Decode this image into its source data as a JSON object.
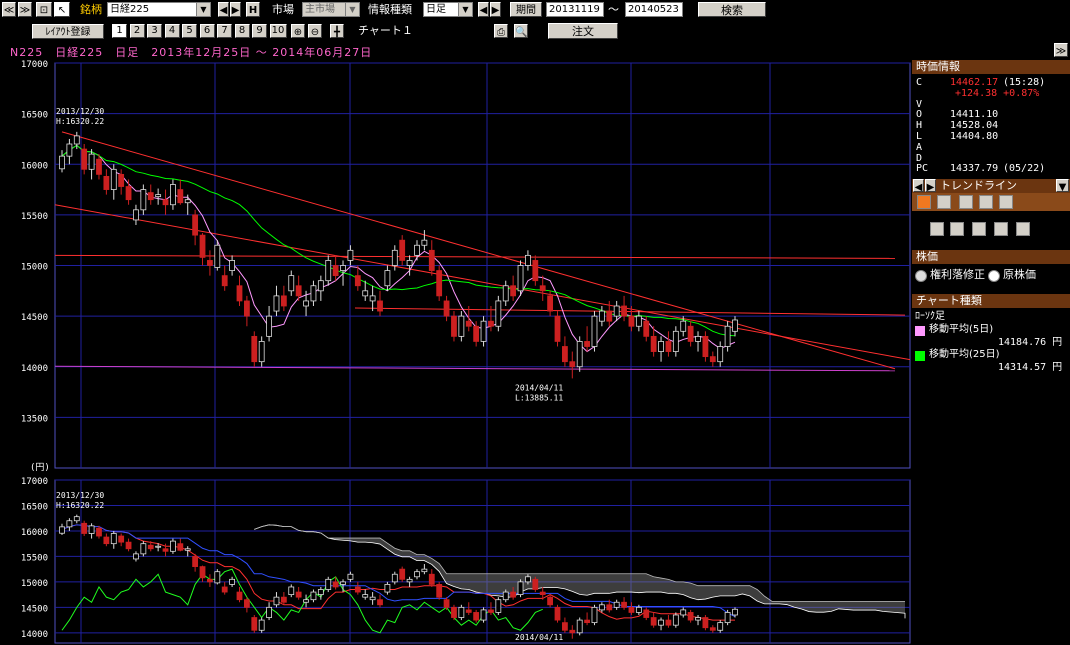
{
  "toolbar": {
    "symbol_label": "銘柄",
    "symbol_value": "日経225",
    "h_button": "H",
    "market_label": "市場",
    "market_value": "主市場",
    "info_label": "情報種類",
    "info_value": "日足",
    "period_label": "期間",
    "period_from": "20131119",
    "tilde": "〜",
    "period_to": "20140523",
    "search_button": "検索",
    "layout_label": "ﾚｲｱｳﾄ登録",
    "layout_numbers": [
      "1",
      "2",
      "3",
      "4",
      "5",
      "6",
      "7",
      "8",
      "9",
      "10"
    ],
    "chart_tab": "チャート１",
    "order_button": "注文"
  },
  "chart_title": "N225　日経225　日足　2013年12月25日 〜 2014年06月27日",
  "chart_data": [
    {
      "type": "candlestick",
      "y_ticks": [
        "17000",
        "16500",
        "16000",
        "15500",
        "15000",
        "14500",
        "14000",
        "13500"
      ],
      "ylim": [
        13000,
        17000
      ],
      "unit_label": "(円)",
      "annotations": [
        {
          "date_text": "2013/12/30",
          "value_text": "H:16320.22"
        },
        {
          "date_text": "2014/04/11",
          "value_text": "L:13885.11"
        }
      ],
      "candles": [
        [
          15955,
          16140,
          15920,
          16080
        ],
        [
          16080,
          16250,
          16000,
          16200
        ],
        [
          16200,
          16320,
          16150,
          16280
        ],
        [
          16150,
          16200,
          15900,
          15950
        ],
        [
          15950,
          16150,
          15850,
          16100
        ],
        [
          16050,
          16100,
          15850,
          15900
        ],
        [
          15880,
          15950,
          15700,
          15750
        ],
        [
          15750,
          16000,
          15650,
          15950
        ],
        [
          15900,
          15950,
          15700,
          15780
        ],
        [
          15780,
          15850,
          15600,
          15650
        ],
        [
          15450,
          15600,
          15400,
          15550
        ],
        [
          15550,
          15800,
          15500,
          15750
        ],
        [
          15720,
          15800,
          15600,
          15650
        ],
        [
          15680,
          15760,
          15600,
          15700
        ],
        [
          15650,
          15750,
          15500,
          15600
        ],
        [
          15600,
          15850,
          15550,
          15800
        ],
        [
          15750,
          15850,
          15600,
          15620
        ],
        [
          15620,
          15700,
          15500,
          15650
        ],
        [
          15500,
          15550,
          15200,
          15300
        ],
        [
          15300,
          15320,
          15000,
          15080
        ],
        [
          15050,
          15150,
          14900,
          15000
        ],
        [
          14980,
          15250,
          14950,
          15200
        ],
        [
          14900,
          15000,
          14750,
          14800
        ],
        [
          14950,
          15100,
          14900,
          15050
        ],
        [
          14800,
          14900,
          14600,
          14650
        ],
        [
          14650,
          14700,
          14400,
          14500
        ],
        [
          14300,
          14350,
          14000,
          14050
        ],
        [
          14050,
          14300,
          14000,
          14250
        ],
        [
          14300,
          14600,
          14250,
          14500
        ],
        [
          14550,
          14800,
          14500,
          14700
        ],
        [
          14700,
          14800,
          14550,
          14600
        ],
        [
          14750,
          14950,
          14700,
          14900
        ],
        [
          14800,
          14900,
          14650,
          14700
        ],
        [
          14600,
          14750,
          14500,
          14650
        ],
        [
          14650,
          14850,
          14600,
          14800
        ],
        [
          14750,
          14900,
          14650,
          14850
        ],
        [
          14850,
          15100,
          14800,
          15050
        ],
        [
          15000,
          15100,
          14850,
          14900
        ],
        [
          14950,
          15050,
          14800,
          15000
        ],
        [
          15050,
          15200,
          15000,
          15150
        ],
        [
          14900,
          15000,
          14750,
          14800
        ],
        [
          14700,
          14850,
          14650,
          14750
        ],
        [
          14650,
          14800,
          14550,
          14700
        ],
        [
          14650,
          14750,
          14500,
          14550
        ],
        [
          14800,
          15000,
          14750,
          14950
        ],
        [
          15000,
          15200,
          14950,
          15150
        ],
        [
          15250,
          15300,
          15000,
          15050
        ],
        [
          15000,
          15100,
          14900,
          15050
        ],
        [
          15100,
          15250,
          15050,
          15200
        ],
        [
          15200,
          15350,
          15150,
          15250
        ],
        [
          15150,
          15250,
          14900,
          14950
        ],
        [
          14950,
          15000,
          14650,
          14700
        ],
        [
          14650,
          14700,
          14450,
          14500
        ],
        [
          14500,
          14550,
          14250,
          14300
        ],
        [
          14300,
          14550,
          14250,
          14500
        ],
        [
          14450,
          14600,
          14350,
          14400
        ],
        [
          14400,
          14450,
          14200,
          14250
        ],
        [
          14250,
          14500,
          14200,
          14450
        ],
        [
          14450,
          14600,
          14350,
          14400
        ],
        [
          14400,
          14700,
          14350,
          14650
        ],
        [
          14650,
          14850,
          14600,
          14800
        ],
        [
          14800,
          14900,
          14650,
          14700
        ],
        [
          14750,
          15050,
          14700,
          15000
        ],
        [
          15000,
          15150,
          14950,
          15100
        ],
        [
          15050,
          15100,
          14800,
          14850
        ],
        [
          14800,
          14900,
          14650,
          14750
        ],
        [
          14700,
          14750,
          14500,
          14550
        ],
        [
          14500,
          14550,
          14200,
          14250
        ],
        [
          14200,
          14300,
          14000,
          14050
        ],
        [
          14050,
          14150,
          13885,
          14000
        ],
        [
          14000,
          14300,
          13950,
          14250
        ],
        [
          14250,
          14400,
          14150,
          14200
        ],
        [
          14200,
          14550,
          14150,
          14500
        ],
        [
          14450,
          14600,
          14400,
          14550
        ],
        [
          14550,
          14650,
          14400,
          14450
        ],
        [
          14500,
          14650,
          14450,
          14600
        ],
        [
          14600,
          14700,
          14450,
          14500
        ],
        [
          14500,
          14600,
          14350,
          14400
        ],
        [
          14400,
          14550,
          14350,
          14500
        ],
        [
          14450,
          14500,
          14250,
          14300
        ],
        [
          14300,
          14400,
          14100,
          14150
        ],
        [
          14150,
          14300,
          14050,
          14250
        ],
        [
          14250,
          14350,
          14100,
          14150
        ],
        [
          14150,
          14400,
          14100,
          14350
        ],
        [
          14350,
          14500,
          14300,
          14450
        ],
        [
          14400,
          14450,
          14200,
          14250
        ],
        [
          14250,
          14350,
          14150,
          14300
        ],
        [
          14300,
          14350,
          14050,
          14100
        ],
        [
          14100,
          14150,
          14000,
          14050
        ],
        [
          14050,
          14250,
          14000,
          14200
        ],
        [
          14200,
          14450,
          14150,
          14400
        ],
        [
          14350,
          14500,
          14300,
          14462
        ]
      ]
    },
    {
      "type": "ichimoku",
      "y_ticks": [
        "17000",
        "16500",
        "16000",
        "15500",
        "15000",
        "14500",
        "14000"
      ],
      "ylim": [
        13800,
        17000
      ],
      "annotations": [
        {
          "date_text": "2013/12/30",
          "value_text": "H:16320.22"
        },
        {
          "date_text": "2014/04/11",
          "value_text": ""
        }
      ]
    }
  ],
  "side": {
    "price_header": "時価情報",
    "rows": [
      {
        "k": "C",
        "v": "14462.17",
        "extra": "(15:28)"
      },
      {
        "k": "",
        "v": "+124.38 +0.87%",
        "extra": ""
      },
      {
        "k": "V",
        "v": "",
        "extra": ""
      },
      {
        "k": "O",
        "v": "14411.10",
        "extra": ""
      },
      {
        "k": "H",
        "v": "14528.04",
        "extra": ""
      },
      {
        "k": "L",
        "v": "14404.80",
        "extra": ""
      },
      {
        "k": "A",
        "v": "",
        "extra": ""
      },
      {
        "k": "D",
        "v": "",
        "extra": ""
      },
      {
        "k": "PC",
        "v": "14337.79",
        "extra": "(05/22)"
      }
    ],
    "trendline_label": "トレンドライン",
    "price_type_header": "株価",
    "radio1": "権利落修正",
    "radio2": "原株価",
    "chart_type_header": "チャート種類",
    "chart_type_value": "ﾛｰｿｸ足",
    "ma5_label": "移動平均(5日)",
    "ma5_value": "14184.76 円",
    "ma25_label": "移動平均(25日)",
    "ma25_value": "14314.57 円",
    "colors": {
      "ma5": "#ff99ff",
      "ma25": "#00ff00",
      "up": "#ffffff",
      "down": "#cc2020",
      "grid": "#2020a0",
      "trend": "#ff3030"
    }
  }
}
